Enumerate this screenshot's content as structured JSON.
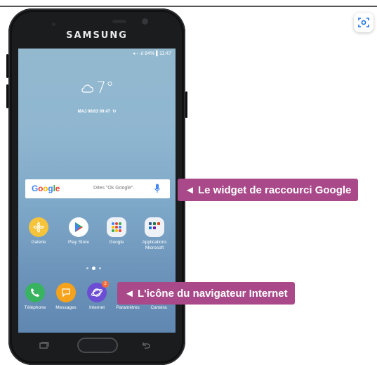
{
  "phone": {
    "brand": "SAMSUNG",
    "status_bar": "◂ ◦ .ıl 84% ▌11:47",
    "weather": {
      "temperature": "7°",
      "icon": "cloud-icon",
      "updated": "MAJ 06/03 09:47"
    },
    "google_widget": {
      "logo": "Google",
      "hint": "Dites \"Ok Google\"."
    },
    "apps_row": [
      {
        "label": "Galerie",
        "icon": "gallery-flower-icon"
      },
      {
        "label": "Play Store",
        "icon": "play-store-icon"
      },
      {
        "label": "Google",
        "icon": "google-folder-icon"
      },
      {
        "label": "Applications\nMicrosoft",
        "icon": "microsoft-folder-icon"
      }
    ],
    "dock": [
      {
        "label": "Téléphone",
        "icon": "phone-icon"
      },
      {
        "label": "Messages",
        "icon": "messages-icon"
      },
      {
        "label": "Internet",
        "icon": "internet-browser-icon",
        "badge": "2"
      },
      {
        "label": "Paramètres",
        "icon": "settings-icon"
      },
      {
        "label": "Caméra",
        "icon": "camera-icon"
      }
    ]
  },
  "callouts": {
    "google_widget": "◄ Le widget de raccourci Google",
    "browser_icon": "◄ L'icône du navigateur Internet"
  },
  "colors": {
    "callout": "#a9498a",
    "wallpaper": "#7ea8c8"
  }
}
